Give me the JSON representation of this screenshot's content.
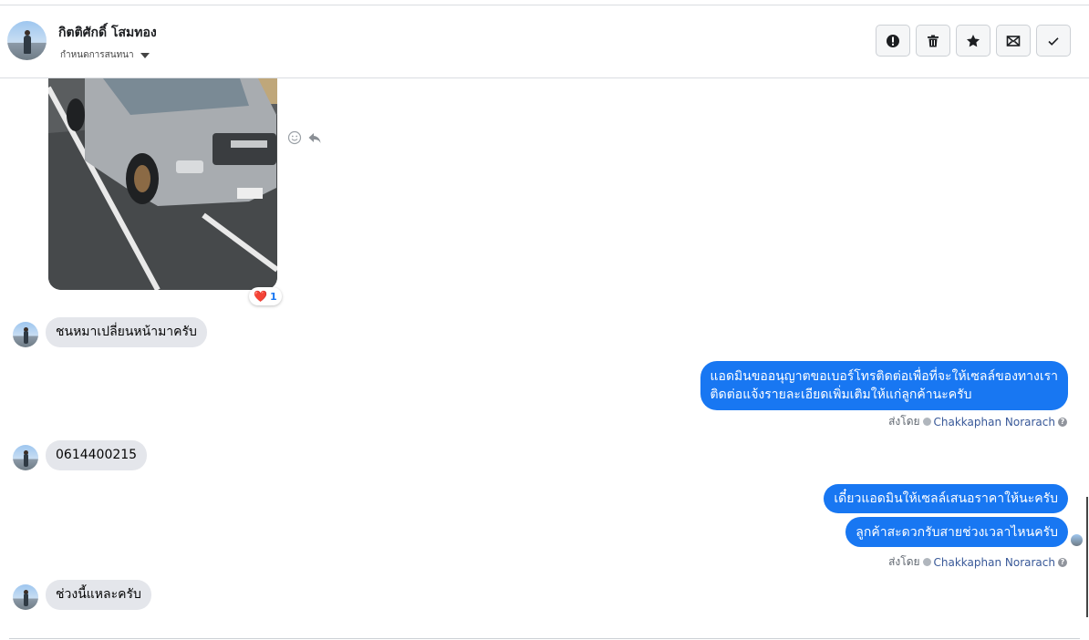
{
  "header": {
    "contact_name": "กิตติศักดิ์ โสมทอง",
    "assign_label": "กำหนดการสนทนา",
    "actions": [
      "report-icon",
      "trash-icon",
      "star-icon",
      "mark-unread-icon",
      "done-check-icon"
    ]
  },
  "messages": [
    {
      "type": "image",
      "from": "customer",
      "reaction": "❤️",
      "reaction_count": "1"
    },
    {
      "type": "text",
      "from": "customer",
      "text": "ชนหมาเปลี่ยนหน้ามาครับ"
    },
    {
      "type": "text",
      "from": "page",
      "lines": [
        "แอดมินขออนุญาตขอเบอร์โทรติดต่อเพื่อที่จะให้เซลล์ของทางเรา",
        "ติดต่อแจ้งรายละเอียดเพิ่มเติมให้แก่ลูกค้านะครับ"
      ]
    },
    {
      "type": "text",
      "from": "customer",
      "text": "0614400215"
    },
    {
      "type": "text",
      "from": "page",
      "text": "เดี๋ยวแอดมินให้เซลล์เสนอราคาให้นะครับ"
    },
    {
      "type": "text",
      "from": "page",
      "text": "ลูกค้าสะดวกรับสายช่วงเวลาไหนครับ"
    },
    {
      "type": "text",
      "from": "customer",
      "text": "ช่วงนี้แหละครับ"
    }
  ],
  "sent_by": {
    "prefix": "ส่งโดย",
    "name": "Chakkaphan Norarach"
  },
  "colors": {
    "outgoing": "#1877f2",
    "incoming": "#e4e6eb",
    "link": "#385898"
  }
}
